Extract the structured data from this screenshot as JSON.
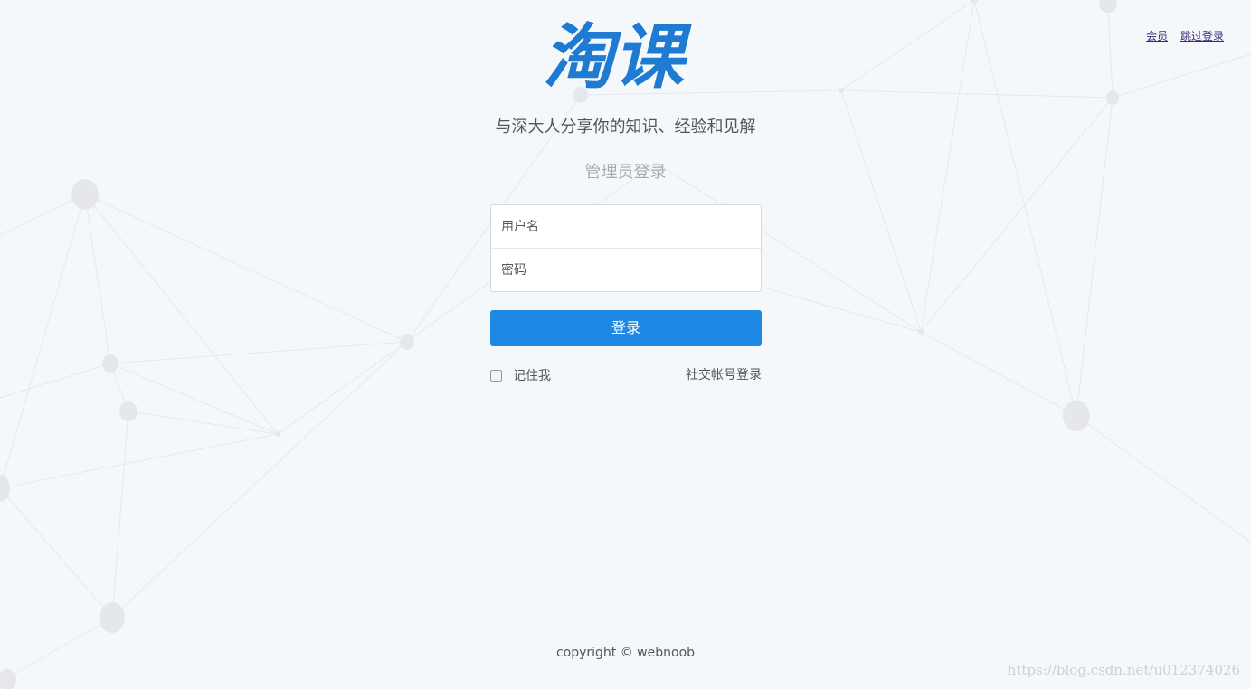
{
  "header": {
    "links": [
      {
        "label": "会员"
      },
      {
        "label": "跳过登录"
      }
    ]
  },
  "brand": {
    "logo_text": "淘课",
    "logo_color": "#1e7bd1",
    "tagline": "与深大人分享你的知识、经验和见解"
  },
  "login": {
    "title": "管理员登录",
    "username_placeholder": "用户名",
    "password_placeholder": "密码",
    "submit_label": "登录",
    "remember_label": "记住我",
    "social_login_label": "社交帐号登录",
    "accent_color": "#1e88e5"
  },
  "footer": {
    "copyright": "copyright © webnoob"
  },
  "watermark": "https://blog.csdn.net/u012374026"
}
